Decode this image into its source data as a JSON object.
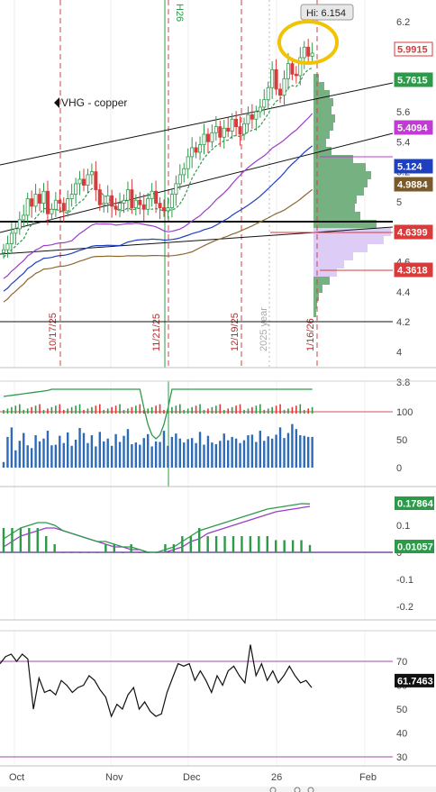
{
  "ticker_label": "VHG - copper",
  "hi_label": "Hi: 6.154",
  "vertical_markers": [
    "10/17/25",
    "11/21/25",
    "12/19/25",
    "2025 year",
    "1/16/26"
  ],
  "top_marker": "H26",
  "x_labels": [
    "Oct",
    "Nov",
    "Dec",
    "26",
    "Feb"
  ],
  "price_ticks": [
    "6.2",
    "6",
    "5.8",
    "5.6",
    "5.4",
    "5.2",
    "5",
    "4.8",
    "4.6",
    "4.4",
    "4.2",
    "4",
    "3.8"
  ],
  "price_badges": [
    {
      "value": "5.9915",
      "color": "#d93a3a",
      "bg": "#ffffff"
    },
    {
      "value": "5.7615",
      "color": "#ffffff",
      "bg": "#2d9a4a"
    },
    {
      "value": "5.4094",
      "color": "#ffffff",
      "bg": "#c03bd1"
    },
    {
      "value": "5.124",
      "color": "#ffffff",
      "bg": "#1e3fbf"
    },
    {
      "value": "4.9884",
      "color": "#ffffff",
      "bg": "#7a5a2a"
    },
    {
      "value": "4.6399",
      "color": "#ffffff",
      "bg": "#d93a3a"
    },
    {
      "value": "4.3618",
      "color": "#ffffff",
      "bg": "#d93a3a"
    }
  ],
  "volume_ticks": [
    "100",
    "50",
    "0"
  ],
  "macd_ticks": [
    "0.1",
    "0",
    "-0.1",
    "-0.2"
  ],
  "macd_badges": [
    {
      "value": "0.17864",
      "color": "#ffffff",
      "bg": "#2d9a4a"
    },
    {
      "value": "0.01057",
      "color": "#ffffff",
      "bg": "#2d9a4a"
    }
  ],
  "rsi_ticks": [
    "70",
    "60",
    "50",
    "40",
    "30"
  ],
  "rsi_badge": {
    "value": "61.7463",
    "color": "#ffffff",
    "bg": "#111111"
  },
  "colors": {
    "up": "#2d9a4a",
    "down": "#d93a3a",
    "ma_green": "#2d9a4a",
    "ma_purple": "#9b3cc9",
    "ma_blue": "#1e3fbf",
    "ma_brown": "#8a6a30",
    "highlight": "#f2c300"
  },
  "chart_data": [
    {
      "type": "candlestick",
      "title": "VHG - copper",
      "x": [
        "Oct",
        "Nov",
        "Dec",
        "26",
        "Feb"
      ],
      "ylim": [
        3.7,
        6.3
      ],
      "series": [
        {
          "values": [
            4.68,
            4.72,
            4.79,
            4.82,
            4.88,
            4.91,
            5.02,
            4.97,
            5.05,
            4.99,
            5.07,
            4.92,
            4.95,
            5.01,
            4.99,
            4.94,
            5.02,
            5.05,
            5.12,
            5.15,
            5.11,
            5.18,
            5.2,
            5.08,
            4.98,
            4.99,
            5.04,
            4.97,
            4.95,
            4.99,
            5.01,
            5.08,
            4.96,
            5.01,
            4.98,
            4.95,
            5.02,
            5.07,
            4.99,
            4.96,
            4.94,
            4.96,
            5.05,
            5.12,
            5.18,
            5.22,
            5.3,
            5.36,
            5.33,
            5.38,
            5.45,
            5.4,
            5.46,
            5.5,
            5.43,
            5.49,
            5.47,
            5.55,
            5.5,
            5.45,
            5.52,
            5.58,
            5.55,
            5.6,
            5.63,
            5.68,
            5.76,
            5.88,
            5.75,
            5.71,
            5.82,
            5.92,
            5.85,
            5.84,
            5.96,
            6.03,
            5.97,
            5.99
          ]
        }
      ],
      "annotations": [
        "Hi: 6.154"
      ]
    },
    {
      "type": "bar",
      "title": "",
      "ylim": [
        0,
        125
      ],
      "series": [
        {
          "values": [
            10,
            55,
            72,
            31,
            48,
            62,
            40,
            35,
            58,
            47,
            52,
            66,
            40,
            41,
            57,
            44,
            63,
            39,
            50,
            71,
            62,
            44,
            58,
            38,
            64,
            47,
            52,
            39,
            60,
            46,
            57,
            69,
            42,
            45,
            41,
            53,
            60,
            38,
            47,
            46,
            66,
            39,
            55,
            61,
            52,
            45,
            51,
            53,
            44,
            64,
            41,
            57,
            45,
            42,
            48,
            61,
            49,
            55,
            52,
            44,
            49,
            58,
            59,
            46,
            66,
            48,
            56,
            52,
            59,
            72,
            53,
            62,
            78,
            69,
            58,
            57,
            55,
            55
          ]
        }
      ]
    },
    {
      "type": "line",
      "title": "",
      "ylim": [
        -0.26,
        0.23
      ],
      "series": [
        {
          "values": [
            0.05,
            0.07,
            0.09,
            0.1,
            0.11,
            0.11,
            0.1,
            0.08,
            0.07,
            0.06,
            0.05,
            0.04,
            0.04,
            0.03,
            0.02,
            0.02,
            0.01,
            0.0,
            0.0,
            0.01,
            0.02,
            0.04,
            0.06,
            0.08,
            0.09,
            0.1,
            0.11,
            0.12,
            0.13,
            0.14,
            0.15,
            0.16,
            0.165,
            0.17,
            0.175,
            0.18,
            0.179
          ]
        },
        {
          "values": [
            0.02,
            0.04,
            0.06,
            0.07,
            0.08,
            0.09,
            0.09,
            0.08,
            0.07,
            0.06,
            0.05,
            0.04,
            0.03,
            0.02,
            0.02,
            0.01,
            0.01,
            0.0,
            0.0,
            0.0,
            0.01,
            0.02,
            0.04,
            0.05,
            0.07,
            0.08,
            0.09,
            0.1,
            0.11,
            0.12,
            0.13,
            0.14,
            0.15,
            0.155,
            0.16,
            0.165,
            0.17
          ]
        }
      ]
    },
    {
      "type": "line",
      "title": "",
      "ylim": [
        25,
        80
      ],
      "series": [
        {
          "values": [
            69,
            72,
            73,
            70,
            73,
            71,
            50,
            63,
            57,
            58,
            56,
            62,
            60,
            57,
            59,
            60,
            64,
            62,
            58,
            55,
            47,
            52,
            50,
            56,
            59,
            50,
            53,
            49,
            47,
            48,
            57,
            63,
            69,
            68,
            69,
            62,
            66,
            62,
            57,
            64,
            60,
            66,
            68,
            64,
            61,
            77,
            64,
            69,
            62,
            66,
            61,
            64,
            68,
            64,
            61,
            62,
            59
          ]
        }
      ]
    }
  ]
}
